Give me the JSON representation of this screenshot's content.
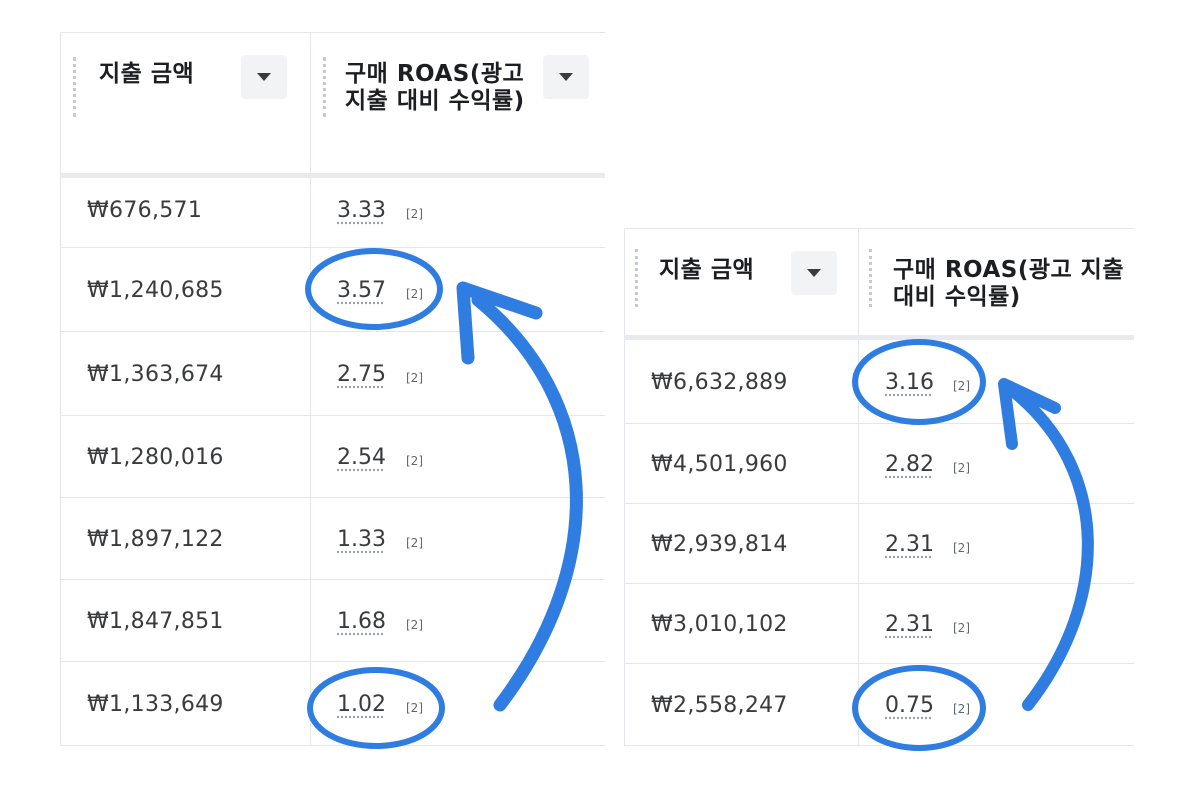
{
  "left_table": {
    "headers": {
      "spend": "지출 금액",
      "roas": "구매 ROAS(광고 지출 대비 수익률)"
    },
    "rows": [
      {
        "spend": "₩676,571",
        "roas": "3.33",
        "ref": "[2]"
      },
      {
        "spend": "₩1,240,685",
        "roas": "3.57",
        "ref": "[2]"
      },
      {
        "spend": "₩1,363,674",
        "roas": "2.75",
        "ref": "[2]"
      },
      {
        "spend": "₩1,280,016",
        "roas": "2.54",
        "ref": "[2]"
      },
      {
        "spend": "₩1,897,122",
        "roas": "1.33",
        "ref": "[2]"
      },
      {
        "spend": "₩1,847,851",
        "roas": "1.68",
        "ref": "[2]"
      },
      {
        "spend": "₩1,133,649",
        "roas": "1.02",
        "ref": "[2]"
      }
    ]
  },
  "right_table": {
    "headers": {
      "spend": "지출 금액",
      "roas": "구매 ROAS(광고 지출 대비 수익률)"
    },
    "rows": [
      {
        "spend": "₩6,632,889",
        "roas": "3.16",
        "ref": "[2]"
      },
      {
        "spend": "₩4,501,960",
        "roas": "2.82",
        "ref": "[2]"
      },
      {
        "spend": "₩2,939,814",
        "roas": "2.31",
        "ref": "[2]"
      },
      {
        "spend": "₩3,010,102",
        "roas": "2.31",
        "ref": "[2]"
      },
      {
        "spend": "₩2,558,247",
        "roas": "0.75",
        "ref": "[2]"
      }
    ]
  },
  "icons": {
    "sort": "chevron-down-icon",
    "drag": "drag-handle-icon",
    "arrow": "curved-arrow-icon"
  },
  "colors": {
    "annotation": "#2f7de1",
    "grid": "#e4e6eb"
  }
}
